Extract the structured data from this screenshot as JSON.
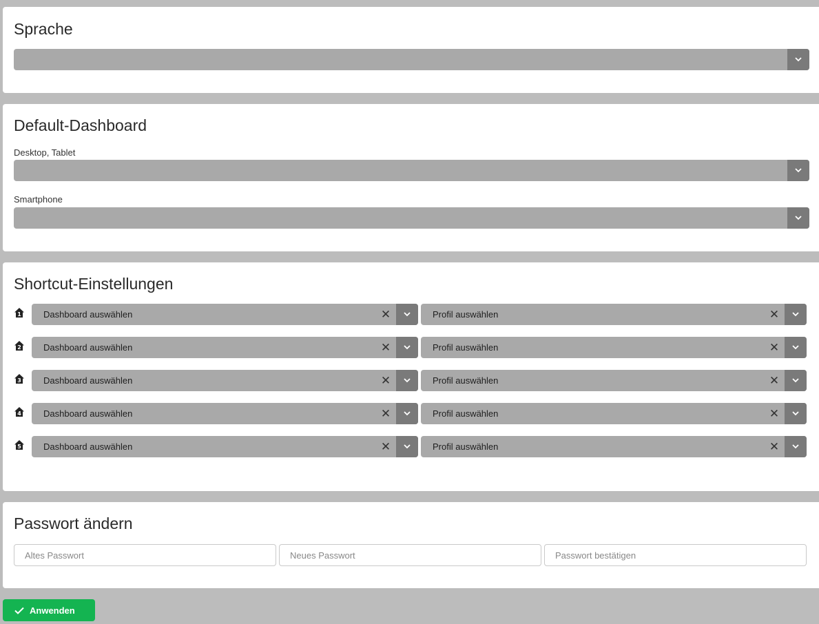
{
  "language": {
    "title": "Sprache",
    "value": ""
  },
  "default_dashboard": {
    "title": "Default-Dashboard",
    "desktop_label": "Desktop, Tablet",
    "desktop_value": "",
    "smartphone_label": "Smartphone",
    "smartphone_value": ""
  },
  "shortcuts": {
    "title": "Shortcut-Einstellungen",
    "rows": [
      {
        "number": "1",
        "dashboard": "Dashboard auswählen",
        "profile": "Profil auswählen"
      },
      {
        "number": "2",
        "dashboard": "Dashboard auswählen",
        "profile": "Profil auswählen"
      },
      {
        "number": "3",
        "dashboard": "Dashboard auswählen",
        "profile": "Profil auswählen"
      },
      {
        "number": "4",
        "dashboard": "Dashboard auswählen",
        "profile": "Profil auswählen"
      },
      {
        "number": "5",
        "dashboard": "Dashboard auswählen",
        "profile": "Profil auswählen"
      }
    ]
  },
  "password": {
    "title": "Passwort ändern",
    "old_placeholder": "Altes Passwort",
    "new_placeholder": "Neues Passwort",
    "confirm_placeholder": "Passwort bestätigen"
  },
  "apply_button": {
    "label": "Anwenden",
    "color": "#14b451"
  },
  "colors": {
    "background": "#bcbcbc",
    "select_fill": "#a9a9a9",
    "select_caret": "#7a7a7a"
  },
  "icons": {
    "dropdown": "chevron-down-icon",
    "clear": "close-icon",
    "shortcut": "home-number-icon",
    "apply": "check-icon"
  }
}
